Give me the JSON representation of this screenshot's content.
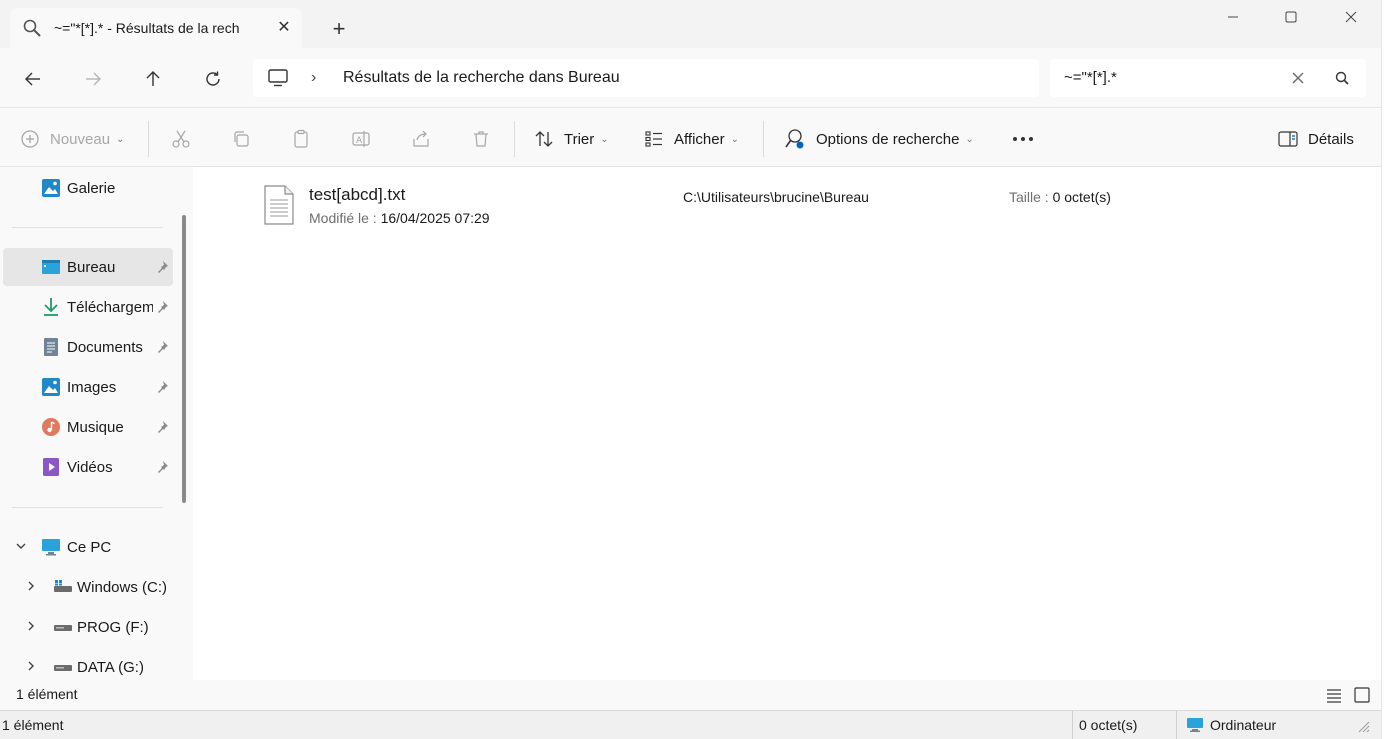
{
  "tab": {
    "title": "~=\"*[*].* - Résultats de la rech"
  },
  "address": {
    "path": "Résultats de la recherche dans Bureau"
  },
  "search": {
    "query": "~=\"*[*].*"
  },
  "toolbar": {
    "new_label": "Nouveau",
    "sort_label": "Trier",
    "view_label": "Afficher",
    "search_options_label": "Options de recherche",
    "details_label": "Détails"
  },
  "sidebar": {
    "items": [
      {
        "label": "Galerie",
        "icon": "gallery-icon"
      },
      {
        "label": "Bureau",
        "icon": "desktop-icon",
        "pinned": true,
        "selected": true
      },
      {
        "label": "Téléchargem",
        "icon": "download-icon",
        "pinned": true
      },
      {
        "label": "Documents",
        "icon": "documents-icon",
        "pinned": true
      },
      {
        "label": "Images",
        "icon": "images-icon",
        "pinned": true
      },
      {
        "label": "Musique",
        "icon": "music-icon",
        "pinned": true
      },
      {
        "label": "Vidéos",
        "icon": "videos-icon",
        "pinned": true
      }
    ],
    "this_pc": "Ce PC",
    "drives": [
      {
        "label": "Windows (C:)"
      },
      {
        "label": "PROG (F:)"
      },
      {
        "label": "DATA (G:)"
      }
    ]
  },
  "results": [
    {
      "name": "test[abcd].txt",
      "modified_label": "Modifié le : ",
      "modified": "16/04/2025 07:29",
      "path": "C:\\Utilisateurs\\brucine\\Bureau",
      "size_label": "Taille : ",
      "size": "0 octet(s)"
    }
  ],
  "status": {
    "count": "1 élément",
    "bottom_count": "1 élément",
    "bottom_size": "0 octet(s)",
    "zone": "Ordinateur"
  },
  "colors": {
    "accent": "#0067c0",
    "folder_blue": "#1e88c8",
    "selected_bg": "#e6e6e6"
  }
}
